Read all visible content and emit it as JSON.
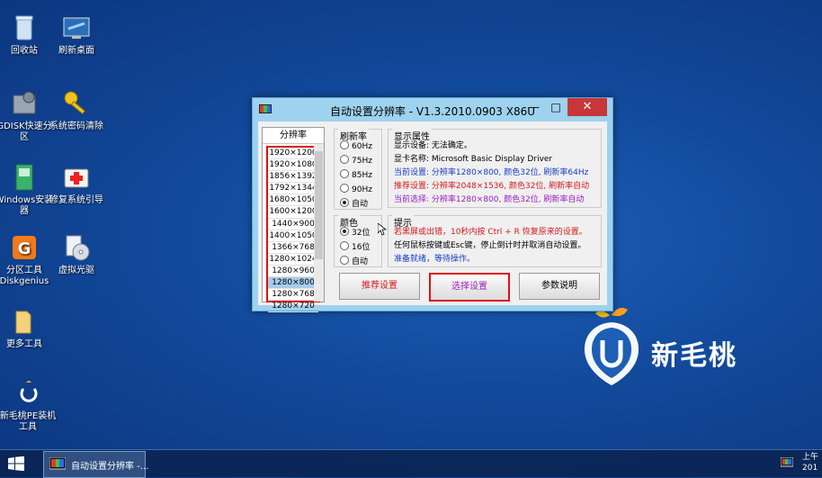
{
  "desktop": {
    "icons": [
      {
        "label": "回收站",
        "icon": "recycle-bin-icon"
      },
      {
        "label": "刷新桌面",
        "icon": "refresh-desktop-icon"
      },
      {
        "label": "GDISK快速分区",
        "icon": "gdisk-icon"
      },
      {
        "label": "系统密码清除",
        "icon": "key-icon"
      },
      {
        "label": "Windows安装器",
        "icon": "windows-installer-icon"
      },
      {
        "label": "修复系统引导",
        "icon": "first-aid-icon"
      },
      {
        "label": "分区工具Diskgenius",
        "icon": "diskgenius-icon"
      },
      {
        "label": "虚拟光驱",
        "icon": "virtual-drive-icon"
      },
      {
        "label": "更多工具",
        "icon": "folder-icon"
      },
      {
        "label": "新毛桃PE装机工具",
        "icon": "pe-installer-icon"
      }
    ],
    "brand": "新毛桃"
  },
  "window": {
    "title": "自动设置分辨率 - V1.3.2010.0903 X86U",
    "minimize": "—",
    "maximize": "□",
    "close": "✕",
    "resolution_header": "分辨率",
    "resolutions": [
      "1920×1200",
      "1920×1080",
      "1856×1392",
      "1792×1344",
      "1680×1050",
      "1600×1200",
      "1440×900",
      "1400×1050",
      "1366×768",
      "1280×1024",
      "1280×960",
      "1280×800",
      "1280×768",
      "1280×720"
    ],
    "selected_resolution": "1280×800",
    "refresh_label": "刷新率",
    "refresh_options": [
      "60Hz",
      "75Hz",
      "85Hz",
      "90Hz",
      "自动"
    ],
    "refresh_selected": "自动",
    "color_label": "颜色",
    "color_options": [
      "32位",
      "16位",
      "自动"
    ],
    "color_selected": "32位",
    "display_label": "显示属性",
    "display_lines": [
      {
        "text": "显示设备: 无法确定。",
        "color": "#000000"
      },
      {
        "text": "显卡名称: Microsoft Basic Display Driver",
        "color": "#000000"
      },
      {
        "text": "当前设置: 分辨率1280×800, 颜色32位, 刷新率64Hz",
        "color": "#1a3cc8"
      },
      {
        "text": "推荐设置: 分辨率2048×1536, 颜色32位, 刷新率自动",
        "color": "#d41a1a"
      },
      {
        "text": "当前选择: 分辨率1280×800, 颜色32位, 刷新率自动",
        "color": "#9b1fbf"
      }
    ],
    "hint_label": "提示",
    "hint_lines": [
      {
        "text": "若黑屏或出错，10秒内按 Ctrl + R 恢复原来的设置。",
        "color": "#d41a1a"
      },
      {
        "text": "任何鼠标按键或Esc键，停止倒计时并取消自动设置。",
        "color": "#000000"
      },
      {
        "text": "准备就绪，等待操作。",
        "color": "#1a3cc8"
      }
    ],
    "buttons": {
      "recommend": "推荐设置",
      "select": "选择设置",
      "about": "参数说明"
    }
  },
  "taskbar": {
    "task_label": "自动设置分辨率 -...",
    "clock_line1": "上午",
    "clock_line2": "201"
  }
}
